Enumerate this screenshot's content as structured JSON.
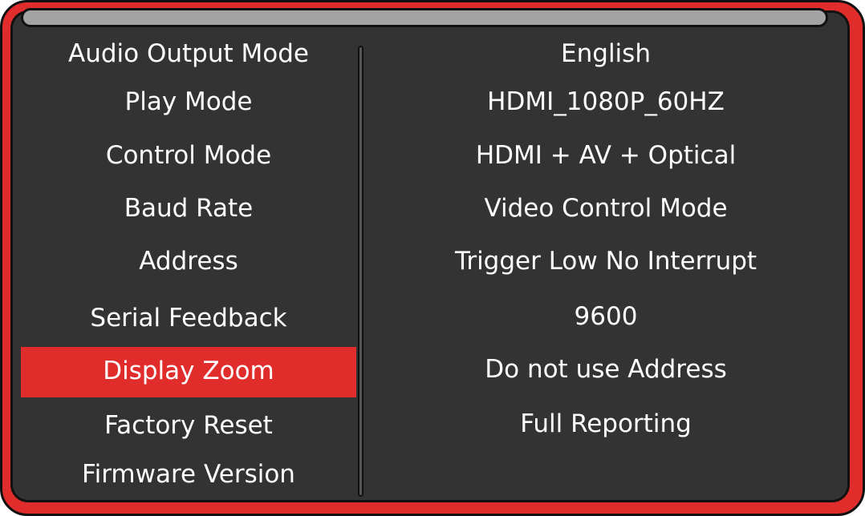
{
  "menu": {
    "selected": "Display Zoom",
    "items": [
      {
        "label": "Audio Output Mode"
      },
      {
        "label": "Play Mode"
      },
      {
        "label": "Control Mode"
      },
      {
        "label": "Baud Rate"
      },
      {
        "label": "Address"
      },
      {
        "label": "Serial Feedback"
      },
      {
        "label": "Display Zoom"
      },
      {
        "label": "Factory Reset"
      },
      {
        "label": "Firmware Version"
      }
    ]
  },
  "values": [
    "English",
    "HDMI_1080P_60HZ",
    "HDMI + AV + Optical",
    "Video Control Mode",
    "Trigger Low No Interrupt",
    "9600",
    "Do not use Address",
    "Full Reporting"
  ],
  "colors": {
    "frame": "#e02d2c",
    "screen": "#333333",
    "highlight": "#e02d2c",
    "text": "#ffffff",
    "scrollbar": "#a3a3a3"
  }
}
